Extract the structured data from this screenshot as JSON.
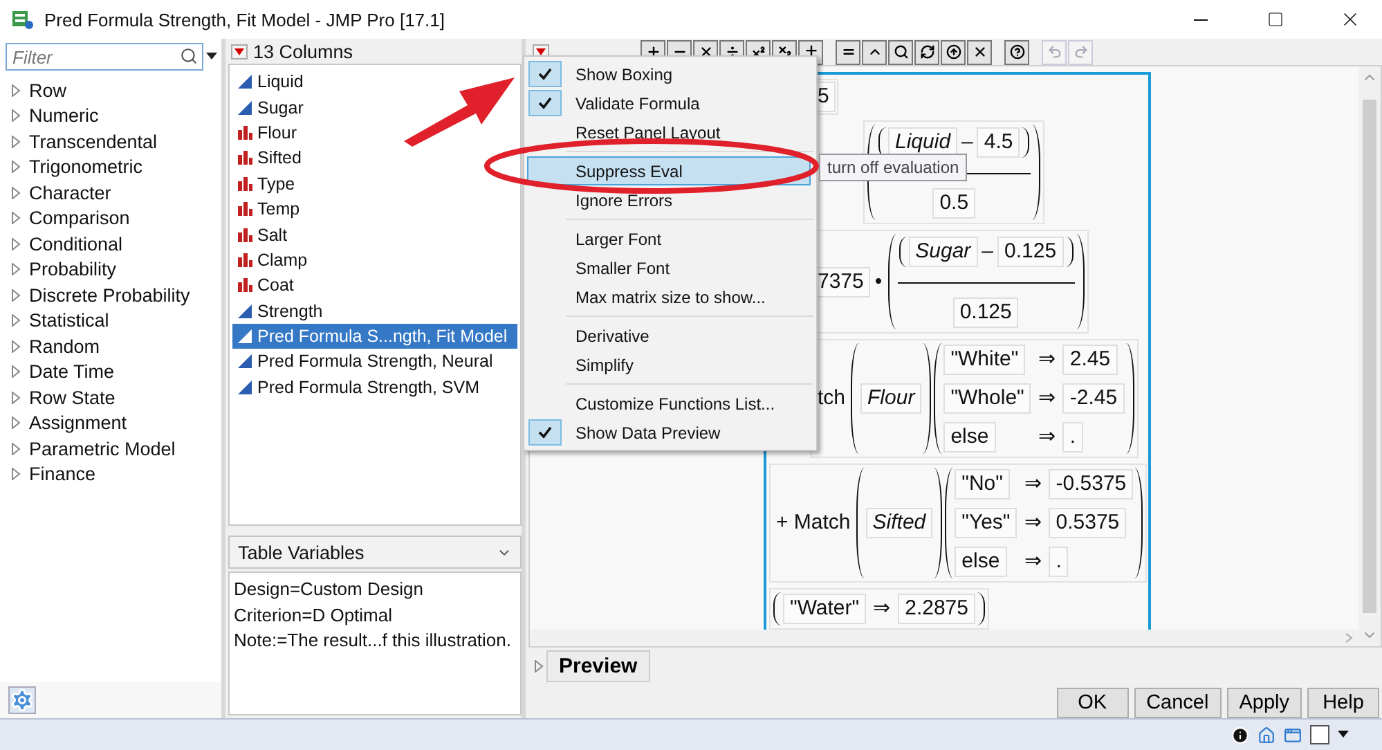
{
  "window": {
    "title": "Pred Formula Strength, Fit Model - JMP Pro [17.1]"
  },
  "functions": {
    "filter_placeholder": "Filter",
    "categories": [
      {
        "label": "Row",
        "expanded": false
      },
      {
        "label": "Numeric",
        "expanded": false
      },
      {
        "label": "Transcendental",
        "expanded": false
      },
      {
        "label": "Trigonometric",
        "expanded": false
      },
      {
        "label": "Character",
        "expanded": false
      },
      {
        "label": "Comparison",
        "expanded": false
      },
      {
        "label": "Conditional",
        "expanded": false
      },
      {
        "label": "Probability",
        "expanded": false
      },
      {
        "label": "Discrete Probability",
        "expanded": false
      },
      {
        "label": "Statistical",
        "expanded": false
      },
      {
        "label": "Random",
        "expanded": false
      },
      {
        "label": "Date Time",
        "expanded": false
      },
      {
        "label": "Row State",
        "expanded": false
      },
      {
        "label": "Assignment",
        "expanded": false
      },
      {
        "label": "Parametric Model",
        "expanded": false
      },
      {
        "label": "Finance",
        "expanded": false
      }
    ]
  },
  "columns": {
    "header": "13 Columns",
    "items": [
      {
        "name": "Liquid",
        "kind": "continuous",
        "selected": false
      },
      {
        "name": "Sugar",
        "kind": "continuous",
        "selected": false
      },
      {
        "name": "Flour",
        "kind": "nominal",
        "selected": false
      },
      {
        "name": "Sifted",
        "kind": "nominal",
        "selected": false
      },
      {
        "name": "Type",
        "kind": "nominal",
        "selected": false
      },
      {
        "name": "Temp",
        "kind": "nominal",
        "selected": false
      },
      {
        "name": "Salt",
        "kind": "nominal",
        "selected": false
      },
      {
        "name": "Clamp",
        "kind": "nominal",
        "selected": false
      },
      {
        "name": "Coat",
        "kind": "nominal",
        "selected": false
      },
      {
        "name": "Strength",
        "kind": "continuous",
        "selected": false
      },
      {
        "name": "Pred Formula S...ngth, Fit Model",
        "kind": "continuous",
        "selected": true
      },
      {
        "name": "Pred Formula Strength, Neural",
        "kind": "continuous",
        "selected": false
      },
      {
        "name": "Pred Formula Strength, SVM",
        "kind": "continuous",
        "selected": false
      }
    ]
  },
  "table_variables": {
    "label": "Table Variables",
    "lines": [
      "Design=Custom Design",
      "Criterion=D Optimal",
      "Note:=The result...f this illustration."
    ]
  },
  "menu": {
    "groups": [
      [
        {
          "label": "Show Boxing",
          "checked": true,
          "selected": false
        },
        {
          "label": "Validate Formula",
          "checked": true,
          "selected": false
        },
        {
          "label": "Reset Panel Layout",
          "checked": false,
          "selected": false
        }
      ],
      [
        {
          "label": "Suppress Eval",
          "checked": false,
          "selected": true
        },
        {
          "label": "Ignore Errors",
          "checked": false,
          "selected": false
        }
      ],
      [
        {
          "label": "Larger Font",
          "checked": false,
          "selected": false
        },
        {
          "label": "Smaller Font",
          "checked": false,
          "selected": false
        },
        {
          "label": "Max matrix size to show...",
          "checked": false,
          "selected": false
        }
      ],
      [
        {
          "label": "Derivative",
          "checked": false,
          "selected": false
        },
        {
          "label": "Simplify",
          "checked": false,
          "selected": false
        }
      ],
      [
        {
          "label": "Customize Functions List...",
          "checked": false,
          "selected": false
        },
        {
          "label": "Show Data Preview",
          "checked": true,
          "selected": false
        }
      ]
    ]
  },
  "tooltip": "turn off evaluation",
  "formula": {
    "rows": [
      {
        "kind": "constant",
        "value": "5"
      },
      {
        "kind": "fraction",
        "variable": "Liquid",
        "operator": "–",
        "center": "4.5",
        "scale": "0.5"
      },
      {
        "kind": "fraction",
        "coefficient": "7375",
        "times": "•",
        "variable": "Sugar",
        "operator": "–",
        "center": "0.125",
        "scale": "0.125"
      },
      {
        "kind": "match",
        "function": "tch",
        "variable": "Flour",
        "cases": [
          {
            "key": "\"White\"",
            "arrow": "⇒",
            "value": "2.45"
          },
          {
            "key": "\"Whole\"",
            "arrow": "⇒",
            "value": "-2.45"
          },
          {
            "key": "else",
            "arrow": "⇒",
            "value": "."
          }
        ]
      },
      {
        "kind": "match",
        "function": "+ Match",
        "variable": "Sifted",
        "cases": [
          {
            "key": "\"No\"",
            "arrow": "⇒",
            "value": "-0.5375"
          },
          {
            "key": "\"Yes\"",
            "arrow": "⇒",
            "value": "0.5375"
          },
          {
            "key": "else",
            "arrow": "⇒",
            "value": "."
          }
        ]
      },
      {
        "kind": "match",
        "cases": [
          {
            "key": "\"Water\"",
            "arrow": "⇒",
            "value": "2.2875"
          }
        ]
      }
    ]
  },
  "preview": {
    "label": "Preview",
    "expanded": false
  },
  "buttons": [
    "OK",
    "Cancel",
    "Apply",
    "Help"
  ]
}
